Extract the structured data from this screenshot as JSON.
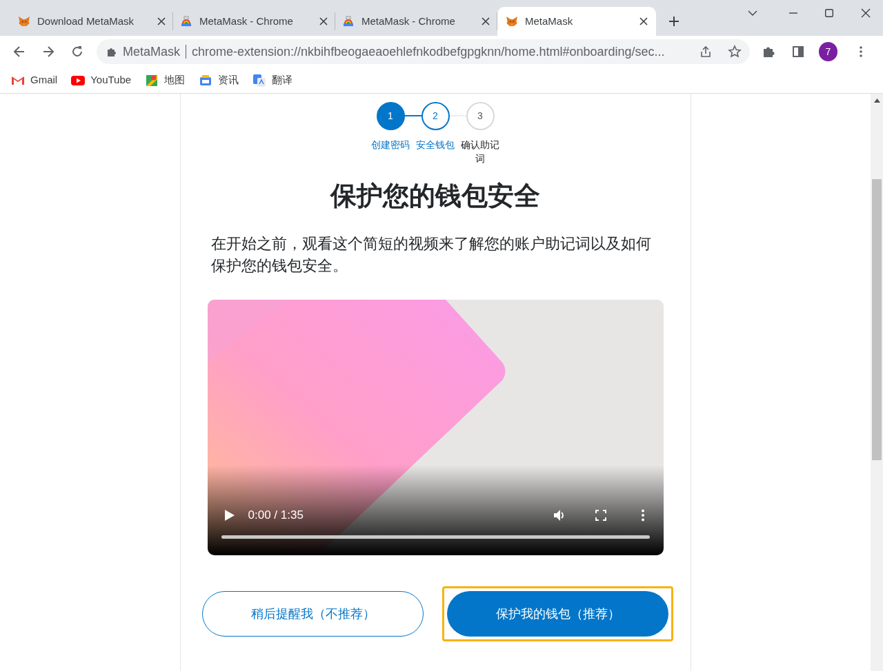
{
  "browser": {
    "tabs": [
      {
        "title": "Download MetaMask",
        "selected": false
      },
      {
        "title": "MetaMask - Chrome",
        "selected": false
      },
      {
        "title": "MetaMask - Chrome",
        "selected": false
      },
      {
        "title": "MetaMask",
        "selected": true
      }
    ],
    "address": {
      "site": "MetaMask",
      "url": "chrome-extension://nkbihfbeogaeaoehlefnkodbefgpgknn/home.html#onboarding/sec..."
    },
    "profile": "7",
    "bookmarks": [
      {
        "label": "Gmail"
      },
      {
        "label": "YouTube"
      },
      {
        "label": "地图"
      },
      {
        "label": "资讯"
      },
      {
        "label": "翻译"
      }
    ]
  },
  "stepper": [
    {
      "number": "1",
      "label": "创建密码",
      "kind": "done"
    },
    {
      "number": "2",
      "label": "安全钱包",
      "kind": "current"
    },
    {
      "number": "3",
      "label": "确认助记词",
      "kind": "pending"
    }
  ],
  "title": "保护您的钱包安全",
  "description": "在开始之前，观看这个简短的视频来了解您的账户助记词以及如何保护您的钱包安全。",
  "video": {
    "time": "0:00 / 1:35",
    "progress": {
      "level": 0
    }
  },
  "buttons": [
    {
      "label": "稍后提醒我（不推荐）",
      "primary": false,
      "focused": false
    },
    {
      "label": "保护我的钱包（推荐）",
      "primary": true,
      "focused": true
    }
  ]
}
